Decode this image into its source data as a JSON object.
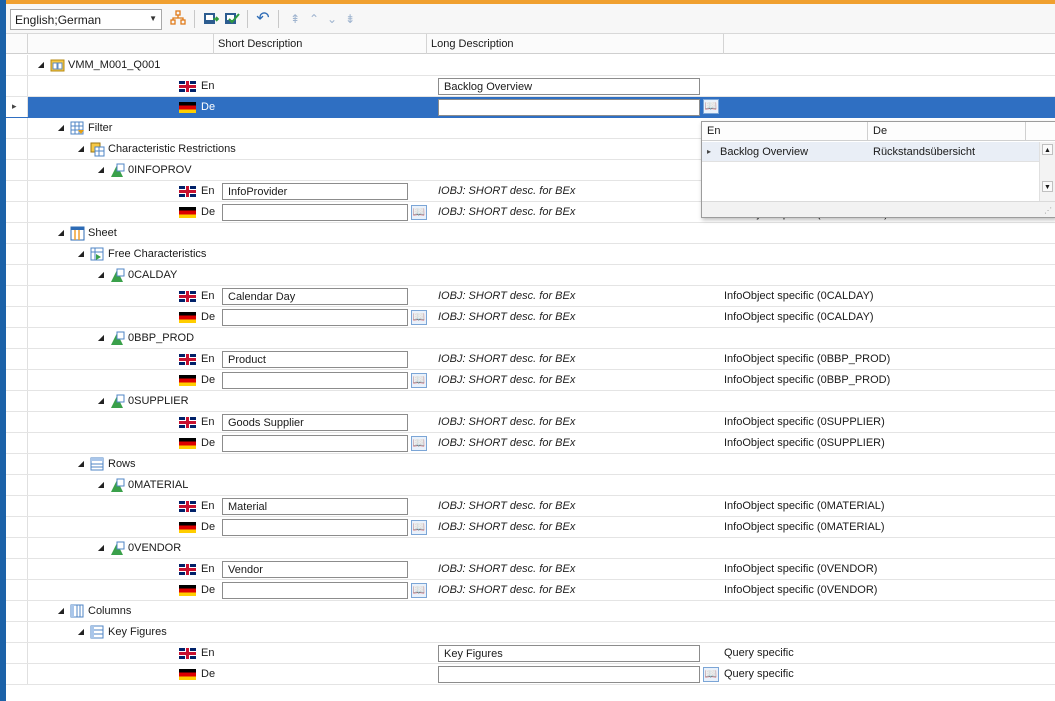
{
  "toolbar": {
    "language_select": "English;German",
    "icons": [
      "hierarchy-icon",
      "export-icon",
      "import-check-icon",
      "undo-icon",
      "collapse-all-icon",
      "collapse-icon",
      "expand-icon",
      "expand-all-icon"
    ]
  },
  "columns": {
    "short": "Short Description",
    "long": "Long Description"
  },
  "tree": {
    "root": "VMM_M001_Q001",
    "filter": "Filter",
    "char_restrictions": "Characteristic Restrictions",
    "infoprov": "0INFOPROV",
    "sheet": "Sheet",
    "free_chars": "Free Characteristics",
    "calday": "0CALDAY",
    "bbp_prod": "0BBP_PROD",
    "supplier": "0SUPPLIER",
    "rows": "Rows",
    "material": "0MATERIAL",
    "vendor": "0VENDOR",
    "columns": "Columns",
    "key_figures": "Key Figures"
  },
  "lang": {
    "en": "En",
    "de": "De"
  },
  "values": {
    "root_en": "Backlog Overview",
    "root_de": "",
    "infoprov_en": "InfoProvider",
    "calday_en": "Calendar Day",
    "bbp_prod_en": "Product",
    "supplier_en": "Goods Supplier",
    "material_en": "Material",
    "vendor_en": "Vendor",
    "keyfig_en": "Key Figures",
    "empty": ""
  },
  "desc": {
    "iobj": "IOBJ: SHORT desc. for BEx",
    "infoprov": "InfoObject specific (0INFOPROV)",
    "calday": "InfoObject specific (0CALDAY)",
    "bbp_prod": "InfoObject specific (0BBP_PROD)",
    "supplier": "InfoObject specific (0SUPPLIER)",
    "material": "InfoObject specific (0MATERIAL)",
    "vendor": "InfoObject specific (0VENDOR)",
    "query": "Query specific"
  },
  "popup": {
    "col_en": "En",
    "col_de": "De",
    "row_en": "Backlog Overview",
    "row_de": "Rückstandsübersicht"
  },
  "colors": {
    "selection": "#2f6fc2",
    "accent_orange": "#f0a030",
    "frame_blue": "#1f6db5"
  }
}
